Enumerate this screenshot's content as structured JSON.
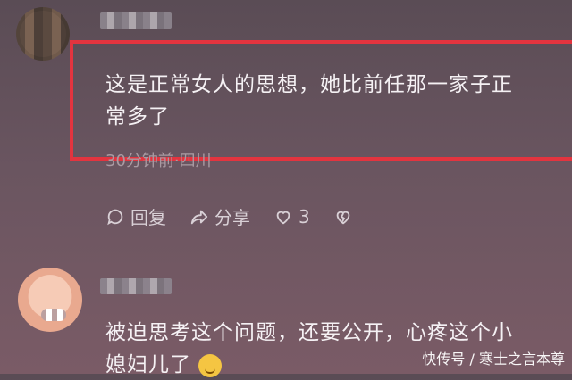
{
  "comments": [
    {
      "text_line1": "这是正常女人的思想，她比前任那一家子正",
      "text_line2": "常多了",
      "meta": "30分钟前·四川",
      "actions": {
        "reply_label": "回复",
        "share_label": "分享",
        "like_count": "3"
      }
    },
    {
      "text_line1": "被迫思考这个问题，还要公开，心疼这个小",
      "text_line2": "媳妇儿了"
    }
  ],
  "watermark": "快传号 / 寒士之言本尊",
  "colors": {
    "highlight_border": "#e3343f"
  }
}
